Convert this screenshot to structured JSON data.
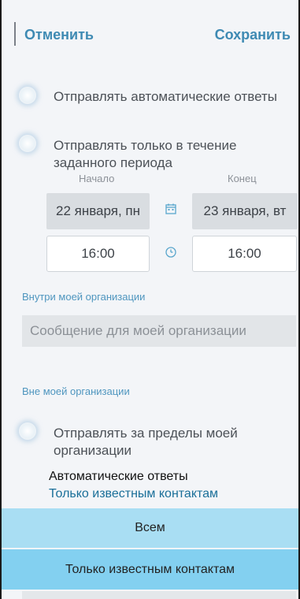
{
  "header": {
    "cancel_label": "Отменить",
    "save_label": "Сохранить"
  },
  "options": {
    "auto_reply": "Отправлять автоматические ответы",
    "period_only": "Отправлять только в течение заданного периода"
  },
  "period": {
    "start_label": "Начало",
    "end_label": "Конец",
    "start_date": "22 января, пн",
    "end_date": "23 января, вт",
    "start_time": "16:00",
    "end_time": "16:00"
  },
  "internal": {
    "title": "Внутри моей организации",
    "placeholder": "Сообщение для моей организации"
  },
  "external": {
    "title": "Вне моей организации",
    "send_outside": "Отправлять за пределы моей организации"
  },
  "dropdown": {
    "title": "Автоматические ответы",
    "selected": "Только известным контактам",
    "options": [
      "Всем",
      "Только известным контактам"
    ]
  },
  "colors": {
    "accent": "#3e8ab3",
    "option_highlight": "#a9def3",
    "option_selected": "#83d0f0"
  }
}
